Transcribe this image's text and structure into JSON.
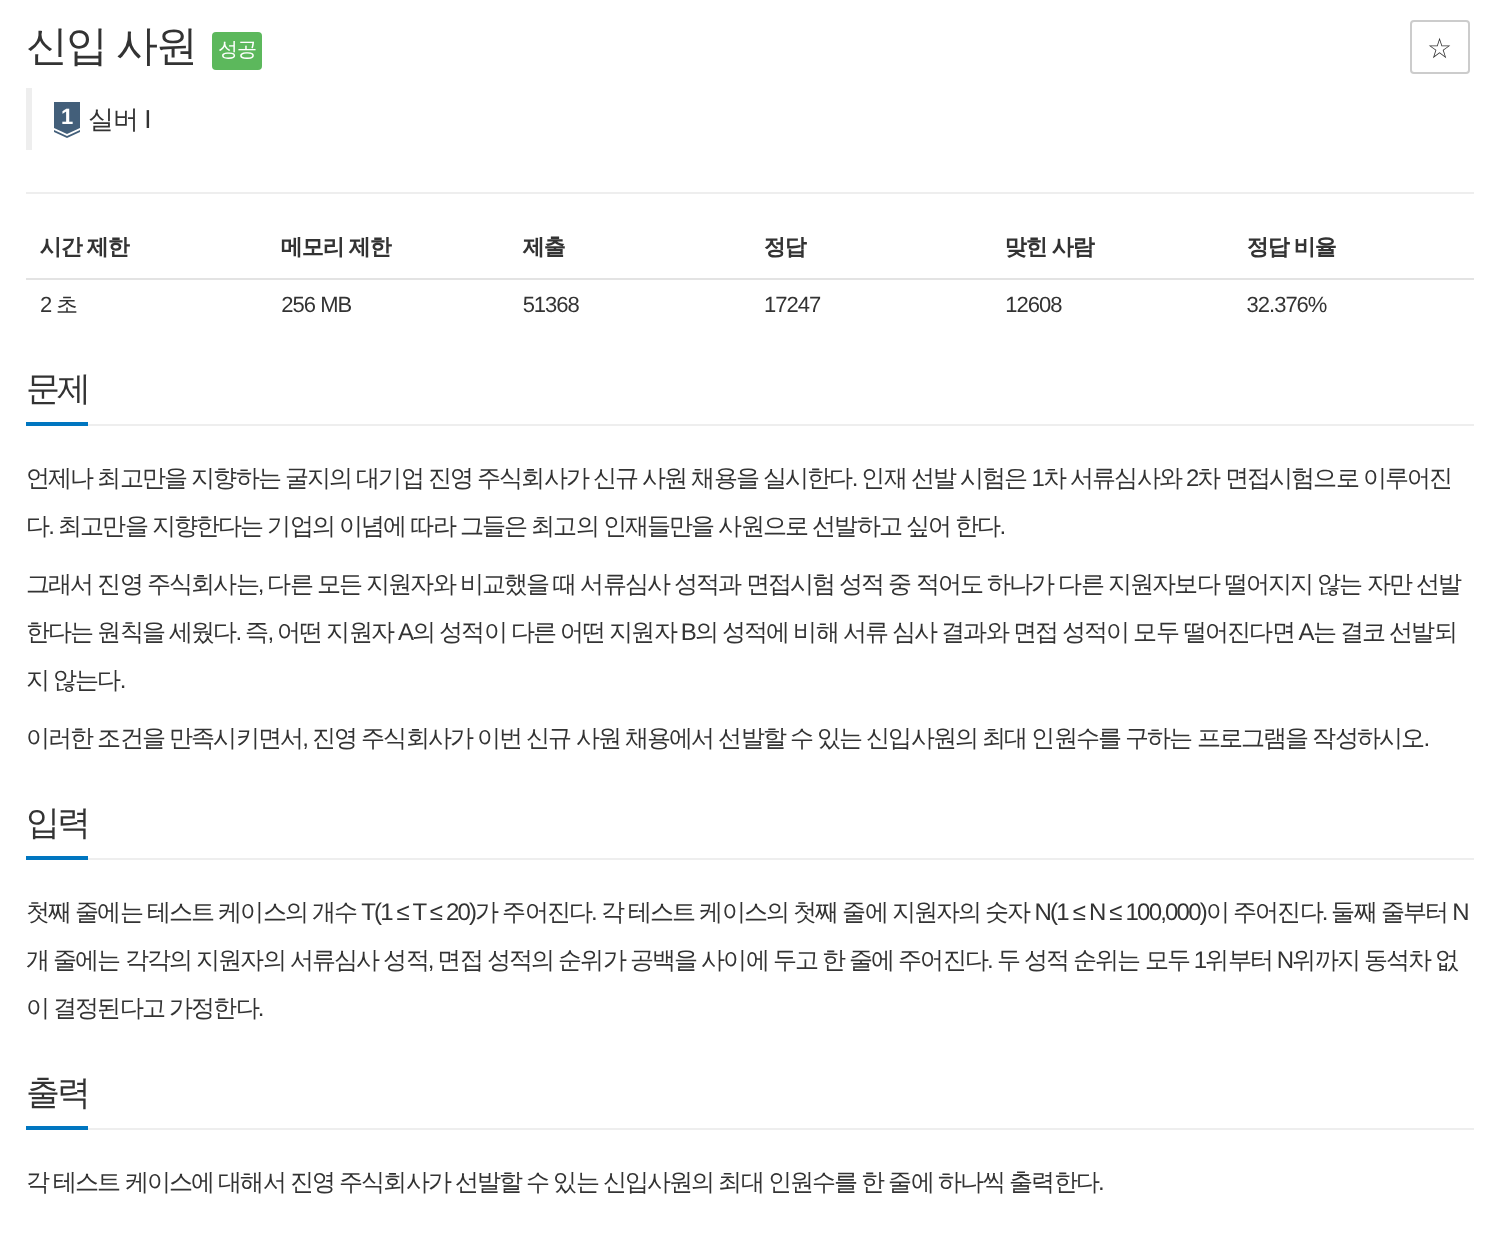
{
  "problem": {
    "title": "신입 사원",
    "result_badge": {
      "label": "성공",
      "kind": "success"
    },
    "tier": {
      "icon_number": "1",
      "label": "실버 I",
      "kind": "silver"
    },
    "bookmark_button": {
      "label": "☆"
    }
  },
  "info_table": {
    "columns": [
      "시간 제한",
      "메모리 제한",
      "제출",
      "정답",
      "맞힌 사람",
      "정답 비율"
    ],
    "rows": [
      [
        "2 초",
        "256 MB",
        "51368",
        "17247",
        "12608",
        "32.376%"
      ]
    ]
  },
  "sections": [
    {
      "heading": "문제",
      "paragraphs": [
        "언제나 최고만을 지향하는 굴지의 대기업 진영 주식회사가 신규 사원 채용을 실시한다. 인재 선발 시험은 1차 서류심사와 2차 면접시험으로 이루어진다. 최고만을 지향한다는 기업의 이념에 따라 그들은 최고의 인재들만을 사원으로 선발하고 싶어 한다.",
        "그래서 진영 주식회사는, 다른 모든 지원자와 비교했을 때 서류심사 성적과 면접시험 성적 중 적어도 하나가 다른 지원자보다 떨어지지 않는 자만 선발한다는 원칙을 세웠다. 즉, 어떤 지원자 A의 성적이 다른 어떤 지원자 B의 성적에 비해 서류 심사 결과와 면접 성적이 모두 떨어진다면 A는 결코 선발되지 않는다.",
        "이러한 조건을 만족시키면서, 진영 주식회사가 이번 신규 사원 채용에서 선발할 수 있는 신입사원의 최대 인원수를 구하는 프로그램을 작성하시오."
      ]
    },
    {
      "heading": "입력",
      "paragraphs": [
        "첫째 줄에는 테스트 케이스의 개수 T(1 ≤ T ≤ 20)가 주어진다. 각 테스트 케이스의 첫째 줄에 지원자의 숫자 N(1 ≤ N ≤ 100,000)이 주어진다. 둘째 줄부터 N개 줄에는 각각의 지원자의 서류심사 성적, 면접 성적의 순위가 공백을 사이에 두고 한 줄에 주어진다. 두 성적 순위는 모두 1위부터 N위까지 동석차 없이 결정된다고 가정한다."
      ]
    },
    {
      "heading": "출력",
      "paragraphs": [
        "각 테스트 케이스에 대해서 진영 주식회사가 선발할 수 있는 신입사원의 최대 인원수를 한 줄에 하나씩 출력한다."
      ]
    }
  ]
}
